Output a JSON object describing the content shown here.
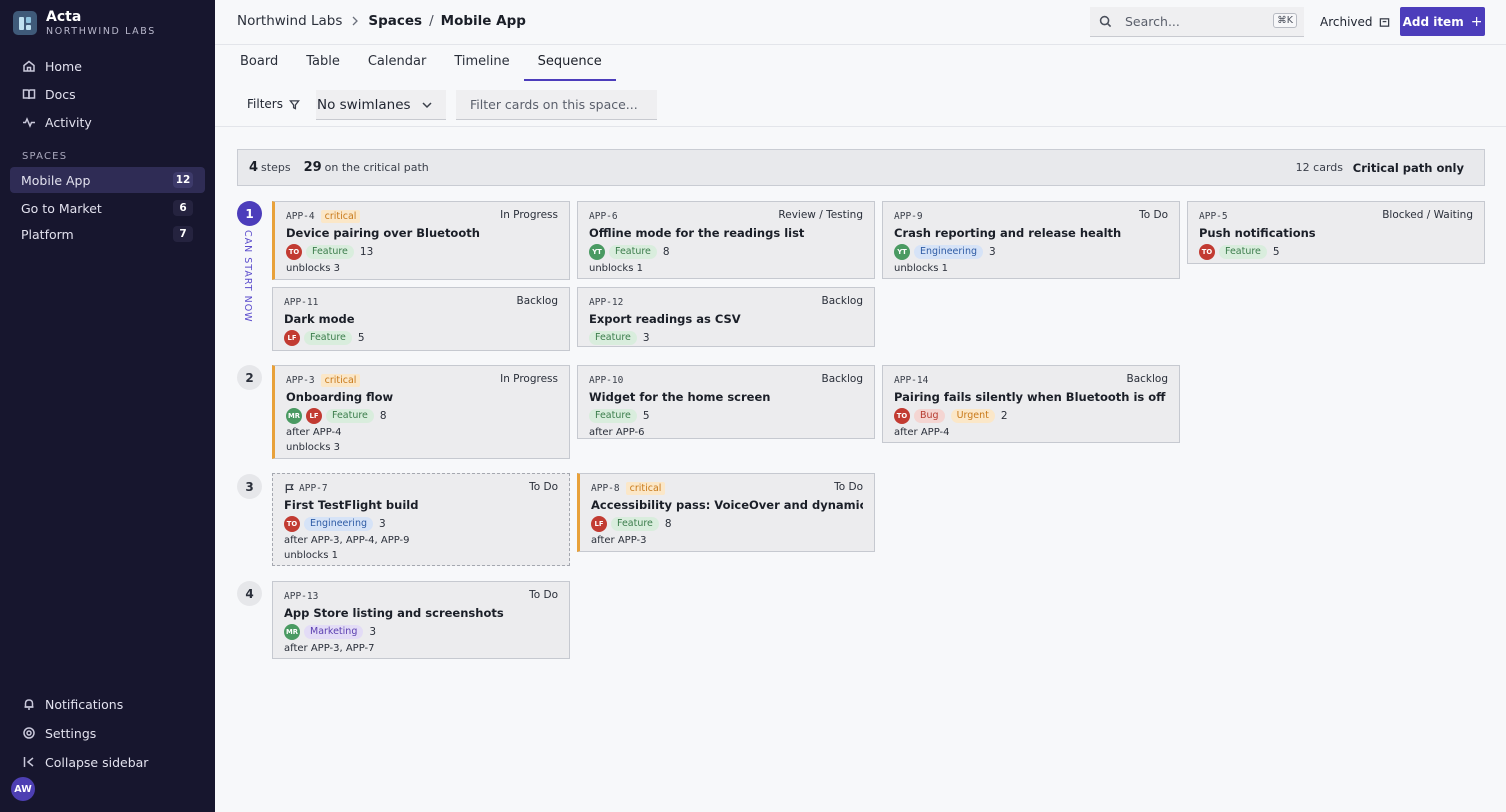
{
  "brand": {
    "name": "Acta",
    "org": "NORTHWIND LABS"
  },
  "nav": [
    {
      "label": "Home",
      "icon": "home-icon"
    },
    {
      "label": "Docs",
      "icon": "book-icon"
    },
    {
      "label": "Activity",
      "icon": "activity-icon"
    }
  ],
  "spaces_label": "SPACES",
  "spaces": [
    {
      "label": "Mobile App",
      "count": "12",
      "active": true
    },
    {
      "label": "Go to Market",
      "count": "6"
    },
    {
      "label": "Platform",
      "count": "7"
    }
  ],
  "bottom_nav": [
    {
      "label": "Notifications",
      "icon": "bell-icon"
    },
    {
      "label": "Settings",
      "icon": "gear-icon"
    },
    {
      "label": "Collapse sidebar",
      "icon": "collapse-icon"
    }
  ],
  "user_initials": "AW",
  "breadcrumb": {
    "org": "Northwind Labs",
    "section": "Spaces",
    "slash": "/",
    "page": "Mobile App"
  },
  "search": {
    "placeholder": "Search...",
    "shortcut": "⌘K"
  },
  "archived_label": "Archived",
  "add_item_label": "Add item",
  "add_item_plus": "+",
  "tabs": [
    {
      "label": "Board"
    },
    {
      "label": "Table"
    },
    {
      "label": "Calendar"
    },
    {
      "label": "Timeline"
    },
    {
      "label": "Sequence",
      "active": true
    }
  ],
  "filters_label": "Filters",
  "swimlane_value": "No swimlanes",
  "filter_placeholder": "Filter cards on this space...",
  "summary": {
    "steps": "4",
    "steps_label": "steps",
    "critical": "29",
    "critical_label": "on the critical path",
    "cards": "12 cards",
    "critical_toggle": "Critical path only"
  },
  "can_start_label": "CAN START NOW",
  "steps": [
    "1",
    "2",
    "3",
    "4"
  ],
  "cards": {
    "app4": {
      "key": "APP-4",
      "badge": "critical",
      "status": "In Progress",
      "title": "Device pairing over Bluetooth",
      "avatars": [
        "TO"
      ],
      "tag": "Feature",
      "points": "13",
      "unblocks": "unblocks 3"
    },
    "app6": {
      "key": "APP-6",
      "status": "Review / Testing",
      "title": "Offline mode for the readings list",
      "avatars": [
        "YT"
      ],
      "tag": "Feature",
      "points": "8",
      "unblocks": "unblocks 1"
    },
    "app9": {
      "key": "APP-9",
      "status": "To Do",
      "title": "Crash reporting and release health",
      "avatars": [
        "YT"
      ],
      "tag": "Engineering",
      "points": "3",
      "unblocks": "unblocks 1"
    },
    "app5": {
      "key": "APP-5",
      "status": "Blocked / Waiting",
      "title": "Push notifications",
      "avatars": [
        "TO"
      ],
      "tag": "Feature",
      "points": "5"
    },
    "app11": {
      "key": "APP-11",
      "status": "Backlog",
      "title": "Dark mode",
      "avatars": [
        "LF"
      ],
      "tag": "Feature",
      "points": "5"
    },
    "app12": {
      "key": "APP-12",
      "status": "Backlog",
      "title": "Export readings as CSV",
      "tag": "Feature",
      "points": "3"
    },
    "app3": {
      "key": "APP-3",
      "badge": "critical",
      "status": "In Progress",
      "title": "Onboarding flow",
      "avatars": [
        "MR",
        "LF"
      ],
      "tag": "Feature",
      "points": "8",
      "after": "after APP-4",
      "unblocks": "unblocks 3"
    },
    "app10": {
      "key": "APP-10",
      "status": "Backlog",
      "title": "Widget for the home screen",
      "tag": "Feature",
      "points": "5",
      "after": "after APP-6"
    },
    "app14": {
      "key": "APP-14",
      "status": "Backlog",
      "title": "Pairing fails silently when Bluetooth is off",
      "avatars": [
        "TO"
      ],
      "tag": "Bug",
      "tag2": "Urgent",
      "points": "2",
      "after": "after APP-4"
    },
    "app7": {
      "key": "APP-7",
      "status": "To Do",
      "title": "First TestFlight build",
      "avatars": [
        "TO"
      ],
      "tag": "Engineering",
      "points": "3",
      "after": "after APP-3, APP-4, APP-9",
      "unblocks": "unblocks 1"
    },
    "app8": {
      "key": "APP-8",
      "badge": "critical",
      "status": "To Do",
      "title": "Accessibility pass: VoiceOver and dynamic type",
      "avatars": [
        "LF"
      ],
      "tag": "Feature",
      "points": "8",
      "after": "after APP-3"
    },
    "app13": {
      "key": "APP-13",
      "status": "To Do",
      "title": "App Store listing and screenshots",
      "avatars": [
        "MR"
      ],
      "tag": "Marketing",
      "points": "3",
      "after": "after APP-3, APP-7"
    }
  },
  "colors": {
    "accent": "#4c3dbb",
    "sidebar": "#17162e",
    "critical": "#e8a13a"
  }
}
